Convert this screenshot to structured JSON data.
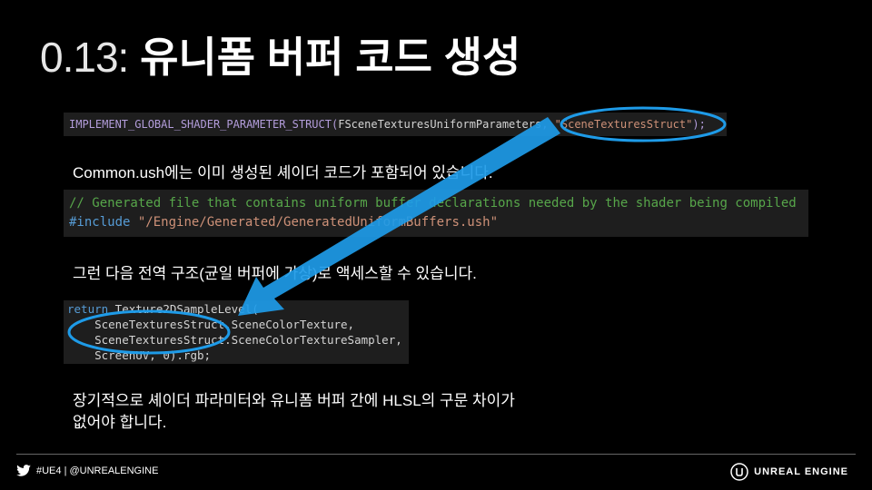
{
  "title": {
    "number": "0.13:",
    "text": "유니폼 버퍼 코드 생성"
  },
  "code1": {
    "macro": "IMPLEMENT_GLOBAL_SHADER_PARAMETER_STRUCT(",
    "arg1": "FSceneTexturesUniformParameters",
    "sep": ", ",
    "arg2": "\"SceneTexturesStruct\"",
    "end": ");"
  },
  "text1": "Common.ush에는 이미 생성된 셰이더 코드가 포함되어 있습니다.",
  "code2": {
    "comment": "// Generated file that contains uniform buffer declarations needed by the shader being compiled",
    "include_kw": "#include",
    "include_path": "\"/Engine/Generated/GeneratedUniformBuffers.ush\""
  },
  "text2": "그런 다음 전역 구조(균일 버퍼에 가상)로 액세스할 수 있습니다.",
  "code3": {
    "kw": "return",
    "call": " Texture2DSampleLevel(",
    "line2": "    SceneTexturesStruct.SceneColorTexture,",
    "line3": "    SceneTexturesStruct.SceneColorTextureSampler,",
    "line4": "    ScreenUV, 0).rgb;"
  },
  "text3": {
    "line1": "장기적으로 셰이더 파라미터와 유니폼 버퍼 간에 HLSL의 구문 차이가",
    "line2": "없어야 합니다."
  },
  "footer": {
    "social": "#UE4 | @UNREALENGINE",
    "brand": "UNREAL ENGINE",
    "twitter_icon": "twitter-bird-icon",
    "logo_icon": "unreal-engine-logo-icon"
  },
  "colors": {
    "annotation_blue": "#1e9be8",
    "code_bg": "#1e1e1e"
  }
}
